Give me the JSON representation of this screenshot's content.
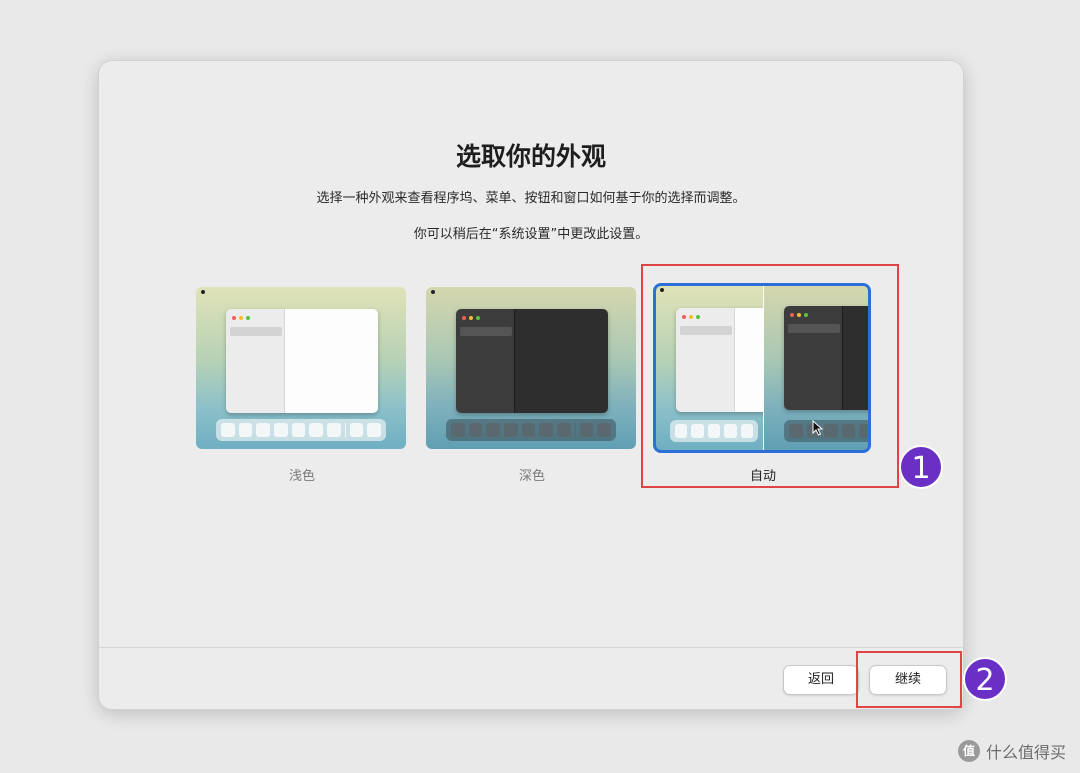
{
  "dialog": {
    "title": "选取你的外观",
    "subtitle_1": "选择一种外观来查看程序坞、菜单、按钮和窗口如何基于你的选择而调整。",
    "subtitle_2": "你可以稍后在“系统设置”中更改此设置。"
  },
  "appearance_options": [
    {
      "label": "浅色",
      "selected": false
    },
    {
      "label": "深色",
      "selected": false
    },
    {
      "label": "自动",
      "selected": true
    }
  ],
  "buttons": {
    "back_label": "返回",
    "continue_label": "继续"
  },
  "annotations": {
    "badge_1": "1",
    "badge_2": "2",
    "callout_color": "#e04545",
    "badge_color": "#6a2fc4"
  },
  "selection_color": "#2d6fd6",
  "watermark": {
    "icon_text": "值",
    "text": "什么值得买"
  }
}
